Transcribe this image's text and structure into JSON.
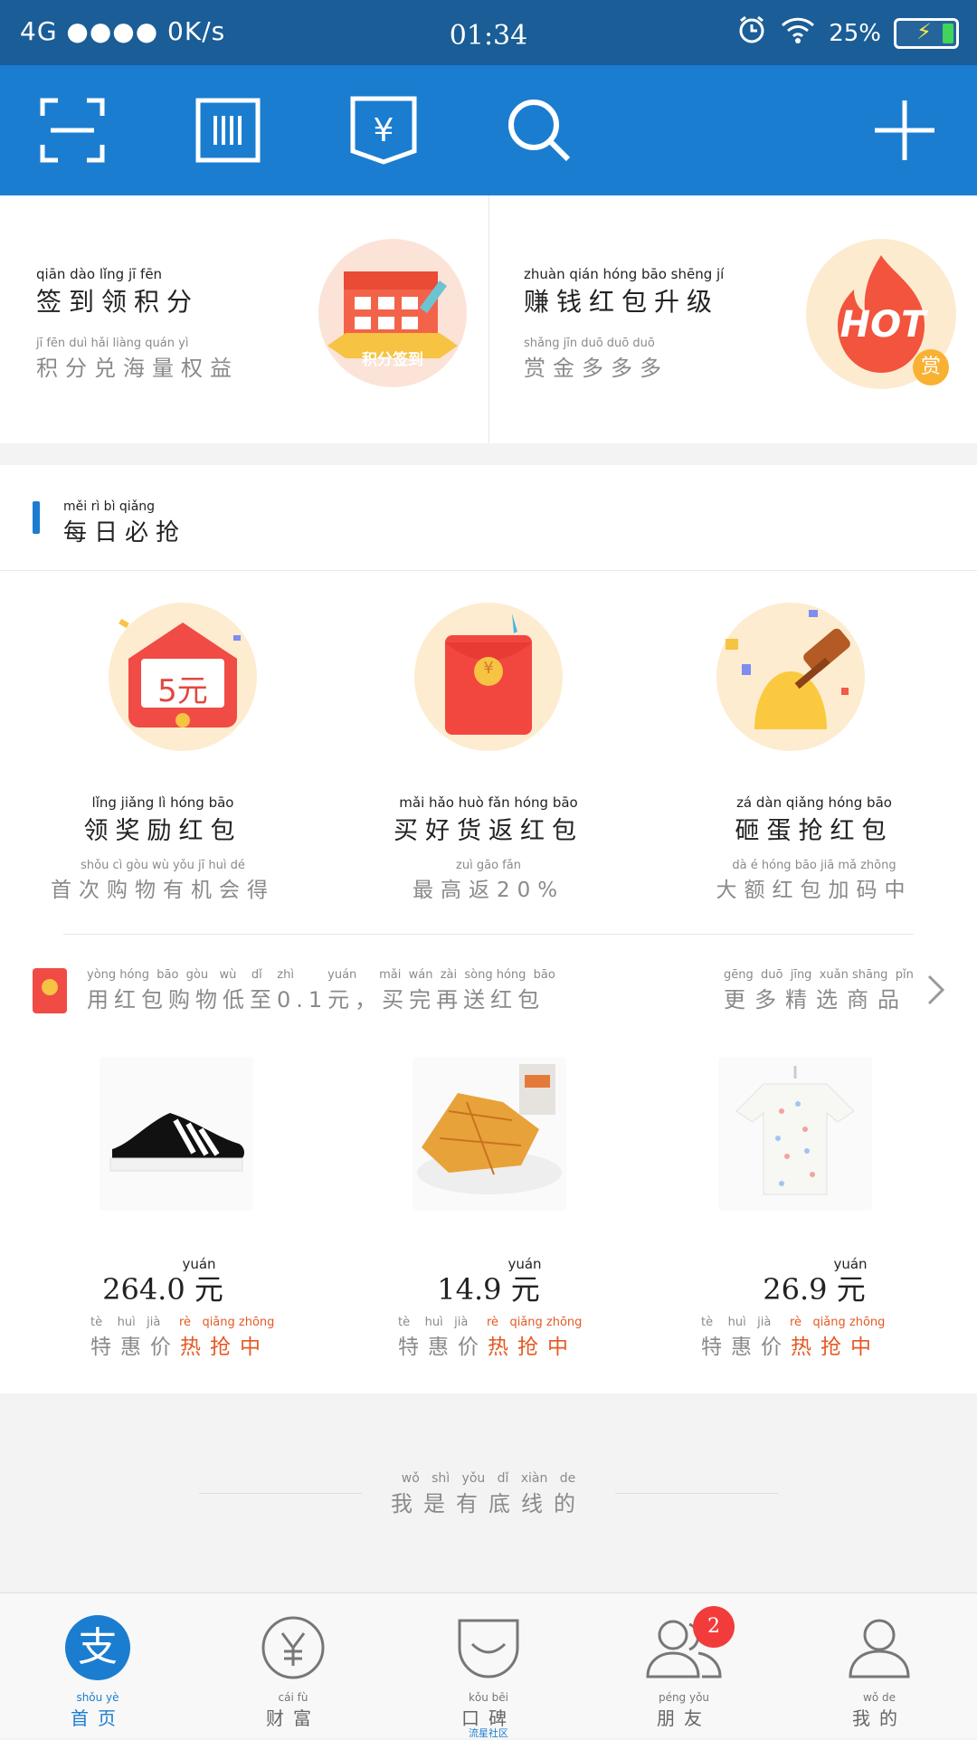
{
  "status": {
    "network": "4G ●●●● 0K/s",
    "time": "01:34",
    "battery": "25%"
  },
  "toolbar": {
    "scan": "scan-icon",
    "paycode": "barcode-icon",
    "cards": "voucher-icon",
    "search": "search-icon",
    "add": "plus-icon"
  },
  "cards": [
    {
      "py": "qiān  dào  lǐng   jī   fēn",
      "title": "签到领积分",
      "subpy": "jī  fēn  duì  hǎi  liàng quán  yì",
      "sub": "积分兑海量权益",
      "badge": "积分签到"
    },
    {
      "py": "zhuàn qián hóng  bāo  shēng   jí",
      "title": "赚钱红包升级",
      "subpy": "shǎng  jīn  duō  duō  duō",
      "sub": "赏金多多多",
      "badge": "HOT",
      "badge2": "赏"
    }
  ],
  "section": {
    "py": "měi   rì    bì   qiǎng",
    "title": "每日必抢"
  },
  "deals": [
    {
      "py": "lǐng  jiǎng   lì   hóng  bāo",
      "title": "领奖励红包",
      "subpy": "shǒu   cì   gòu   wù   yǒu    jī    huì   dé",
      "sub": "首次购物有机会得",
      "art": "5元"
    },
    {
      "py": "mǎi   hǎo   huò   fǎn  hóng  bāo",
      "title": "买好货返红包",
      "subpy": "zuì   gāo   fǎn",
      "sub": "最高返20%",
      "art": "¥"
    },
    {
      "py": "zá    dàn  qiǎng hóng  bāo",
      "title": "砸蛋抢红包",
      "subpy": "dà     é    hóng  bāo   jiā   mǎ  zhōng",
      "sub": "大额红包加码中",
      "art": ""
    }
  ],
  "promo": {
    "py": "yòng hóng  bāo  gòu   wù    dǐ    zhì         yuán      mǎi  wán  zài  sòng hóng  bāo",
    "text": "用红包购物低至0.1元，买完再送红包",
    "morepy": "gēng  duō  jīng  xuǎn shāng  pǐn",
    "more": "更多精选商品"
  },
  "products": [
    {
      "price": "264.0",
      "unit": "元",
      "unitpy": "yuán",
      "tagpy": "tè    huì   jià",
      "tag": "特惠价",
      "hotpy": "rè   qiǎng zhōng",
      "hot": "热抢中"
    },
    {
      "price": "14.9",
      "unit": "元",
      "unitpy": "yuán",
      "tagpy": "tè    huì   jià",
      "tag": "特惠价",
      "hotpy": "rè   qiǎng zhōng",
      "hot": "热抢中"
    },
    {
      "price": "26.9",
      "unit": "元",
      "unitpy": "yuán",
      "tagpy": "tè    huì   jià",
      "tag": "特惠价",
      "hotpy": "rè   qiǎng zhōng",
      "hot": "热抢中"
    }
  ],
  "footer": {
    "py": "wǒ   shì   yǒu   dǐ   xiàn   de",
    "text": "我是有底线的"
  },
  "tabs": [
    {
      "py": "shǒu    yè",
      "label": "首页",
      "active": true
    },
    {
      "py": "cái     fù",
      "label": "财富"
    },
    {
      "py": "kǒu    bēi",
      "label": "口碑",
      "sub": "流星社区"
    },
    {
      "py": "péng  yǒu",
      "label": "朋友",
      "badge": "2"
    },
    {
      "py": "wǒ     de",
      "label": "我的"
    }
  ],
  "colors": {
    "primary": "#1b7dd0",
    "statusbar": "#1a5d97",
    "hot": "#e45a25",
    "badge": "#f23c3c"
  }
}
